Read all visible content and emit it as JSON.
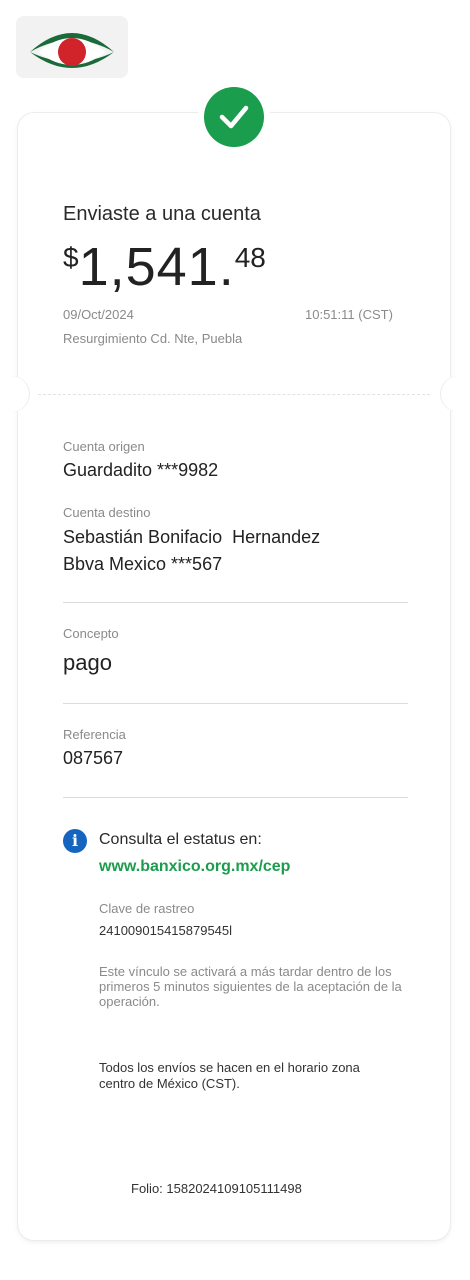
{
  "header": {
    "logo_icon": "bank-logo-icon",
    "status_icon": "check-icon",
    "colors": {
      "success": "#1b9d4e",
      "brand_green": "#1b6b3a",
      "brand_red": "#d0232a",
      "info": "#1565c0"
    }
  },
  "summary": {
    "title": "Enviaste a una cuenta",
    "currency": "$",
    "amount_int": "1,541.",
    "amount_dec": "48",
    "date": "09/Oct/2024",
    "time": "10:51:11 (CST)",
    "location": "Resurgimiento Cd. Nte, Puebla"
  },
  "details": {
    "origin_label": "Cuenta origen",
    "origin_value": "Guardadito ***9982",
    "dest_label": "Cuenta destino",
    "dest_name": "Sebastián Bonifacio  Hernandez",
    "dest_bank": "Bbva Mexico ***567",
    "concept_label": "Concepto",
    "concept_value": "pago",
    "ref_label": "Referencia",
    "ref_value": "087567"
  },
  "status": {
    "info_icon": "info-icon",
    "consult_text": "Consulta el estatus en:",
    "link": "www.banxico.org.mx/cep",
    "tracking_label": "Clave de rastreo",
    "tracking_value": "241009015415879545l",
    "note": "Este vínculo se activará a más tardar dentro de los primeros 5 minutos siguientes de la aceptación de la operación.",
    "schedule_note": "Todos los envíos se hacen en el horario zona centro de México (CST)."
  },
  "footer": {
    "folio": "Folio: 1582024109105111498"
  }
}
